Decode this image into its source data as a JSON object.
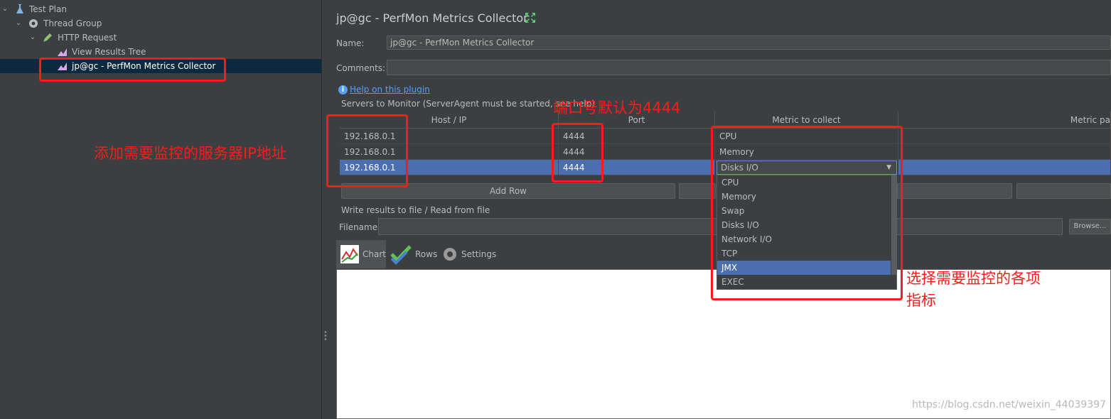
{
  "tree": {
    "items": [
      {
        "label": "Test Plan",
        "icon": "flask-icon"
      },
      {
        "label": "Thread Group",
        "icon": "gear-icon"
      },
      {
        "label": "HTTP Request",
        "icon": "pen-icon"
      },
      {
        "label": "View Results Tree",
        "icon": "graph-icon"
      },
      {
        "label": "jp@gc - PerfMon Metrics Collector",
        "icon": "graph-icon"
      }
    ]
  },
  "panel": {
    "title": "jp@gc - PerfMon Metrics Collector",
    "name_label": "Name:",
    "name_value": "jp@gc - PerfMon Metrics Collector",
    "comments_label": "Comments:",
    "comments_value": "",
    "help_link": "Help on this plugin",
    "servers_label": "Servers to Monitor (ServerAgent must be started, see help)",
    "write_results_label": "Write results to file / Read from file",
    "filename_label": "Filename",
    "filename_value": "",
    "browse_label": "Browse..."
  },
  "table": {
    "columns": [
      "Host / IP",
      "Port",
      "Metric to collect",
      "Metric pa"
    ],
    "rows": [
      {
        "host": "192.168.0.1",
        "port": "4444",
        "metric": "CPU"
      },
      {
        "host": "192.168.0.1",
        "port": "4444",
        "metric": "Memory"
      },
      {
        "host": "192.168.0.1",
        "port": "4444",
        "metric": "Disks I/O"
      }
    ],
    "selected_row": 2,
    "add_row_label": "Add Row"
  },
  "dropdown": {
    "options": [
      "CPU",
      "Memory",
      "Swap",
      "Disks I/O",
      "Network I/O",
      "TCP",
      "JMX",
      "EXEC"
    ],
    "highlighted": "JMX"
  },
  "tabs": [
    {
      "label": "Chart",
      "icon": "chart-icon"
    },
    {
      "label": "Rows",
      "icon": "checkmark-icon"
    },
    {
      "label": "Settings",
      "icon": "gear-icon"
    }
  ],
  "annotations": {
    "ip_note": "添加需要监控的服务器IP地址",
    "port_note": "端口号默认为4444",
    "metric_note_line1": "选择需要监控的各项",
    "metric_note_line2": "指标"
  },
  "watermark": "https://blog.csdn.net/weixin_44039397",
  "colors": {
    "background": "#3c3f41",
    "selection": "#4b6eaf",
    "tree_selection": "#0d293e",
    "annotation": "#ff1a1a",
    "link": "#589df6"
  }
}
